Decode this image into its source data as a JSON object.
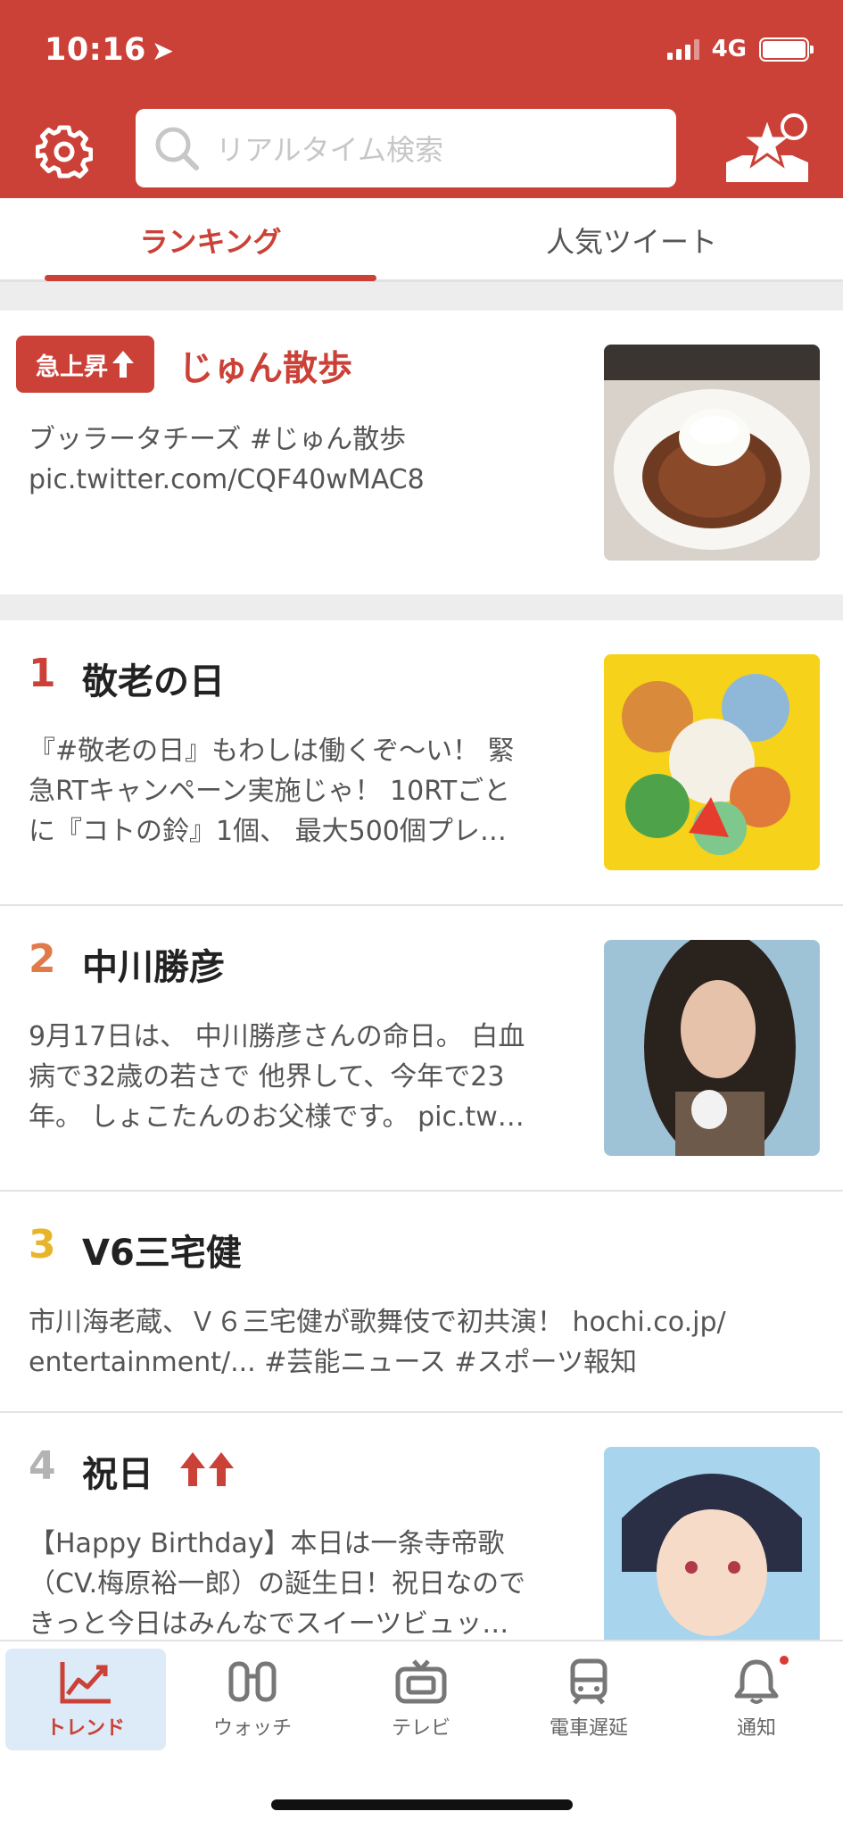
{
  "status": {
    "time": "10:16",
    "network": "4G"
  },
  "header": {
    "search_placeholder": "リアルタイム検索"
  },
  "tabs": [
    {
      "label": "ランキング",
      "active": true
    },
    {
      "label": "人気ツイート",
      "active": false
    }
  ],
  "rising": {
    "badge": "急上昇",
    "title": "じゅん散歩",
    "line1": "ブッラータチーズ #じゅん散歩",
    "line2": "pic.twitter.com/CQF40wMAC8"
  },
  "ranking": [
    {
      "rank": "1",
      "title": "敬老の日",
      "lines": [
        "『#敬老の日』もわしは働くぞ〜い！ 緊",
        "急RTキャンペーン実施じゃ！ 10RTごと",
        "に『コトの鈴』1個、 最大500個プレ…"
      ],
      "rank_color": "#cb4137"
    },
    {
      "rank": "2",
      "title": "中川勝彦",
      "lines": [
        "9月17日は、 中川勝彦さんの命日。 白血",
        "病で32歳の若さで 他界して、今年で23",
        "年。 しょこたんのお父様です。 pic.tw…"
      ],
      "rank_color": "#e07a4a"
    },
    {
      "rank": "3",
      "title": "V6三宅健",
      "lines": [
        "市川海老蔵、Ｖ６三宅健が歌舞伎で初共演！ hochi.co.jp/",
        "entertainment/... #芸能ニュース #スポーツ報知"
      ],
      "rank_color": "#e8b42a"
    },
    {
      "rank": "4",
      "title": "祝日",
      "lines": [
        "【Happy Birthday】本日は一条寺帝歌",
        "（CV.梅原裕一郎）の誕生日！祝日なので",
        "きっと今日はみんなでスイーツビュッ…"
      ],
      "rank_color": "#b3b3b3"
    }
  ],
  "tabbar": [
    {
      "label": "トレンド",
      "icon": "trend-chart-icon",
      "active": true
    },
    {
      "label": "ウォッチ",
      "icon": "binoculars-icon",
      "active": false
    },
    {
      "label": "テレビ",
      "icon": "tv-icon",
      "active": false
    },
    {
      "label": "電車遅延",
      "icon": "train-icon",
      "active": false
    },
    {
      "label": "通知",
      "icon": "bell-icon",
      "active": false
    }
  ],
  "colors": {
    "brand": "#cb4137",
    "tab_active_bg": "#ddeaf8"
  }
}
